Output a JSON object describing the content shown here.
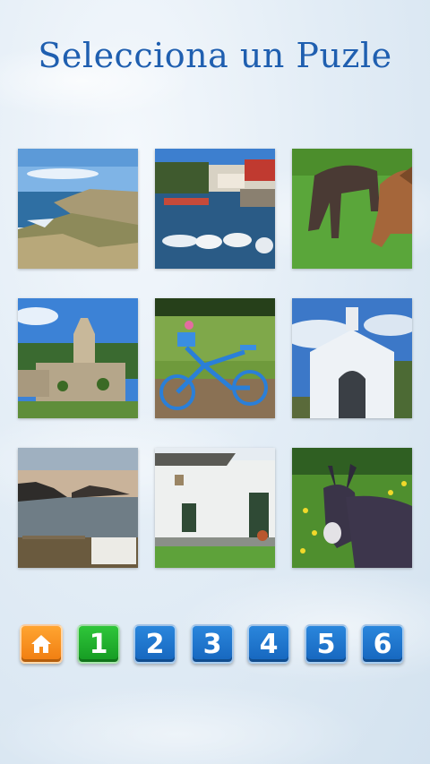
{
  "title": "Selecciona un Puzle",
  "puzzles": [
    {
      "icon": "coast-cliffs-photo"
    },
    {
      "icon": "harbor-boats-photo"
    },
    {
      "icon": "horses-grazing-photo"
    },
    {
      "icon": "stone-church-photo"
    },
    {
      "icon": "blue-bicycle-photo"
    },
    {
      "icon": "white-chapel-photo"
    },
    {
      "icon": "sunset-bay-photo"
    },
    {
      "icon": "white-house-photo"
    },
    {
      "icon": "donkey-photo"
    }
  ],
  "nav": {
    "home_icon": "home-icon",
    "levels": [
      "1",
      "2",
      "3",
      "4",
      "5",
      "6"
    ],
    "active_level": "1"
  },
  "colors": {
    "title": "#1f5fb0",
    "home": "#f58a1c",
    "active": "#1faa2c",
    "level": "#1e74cf"
  }
}
